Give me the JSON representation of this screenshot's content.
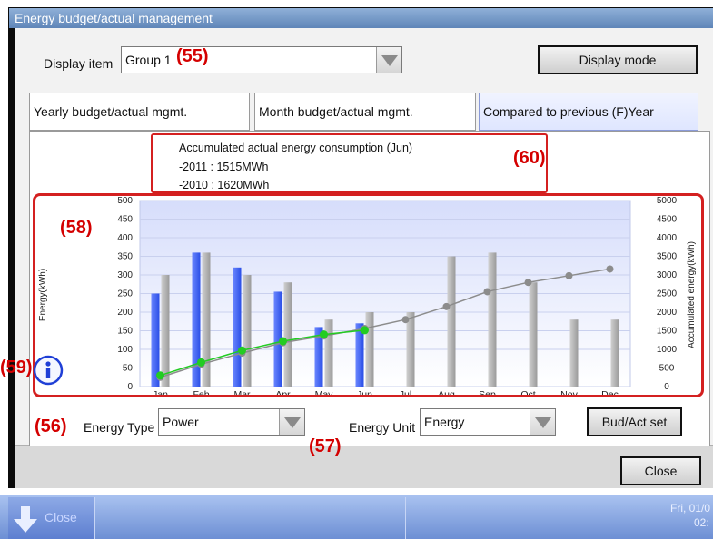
{
  "window": {
    "title": "Energy budget/actual management"
  },
  "display_item": {
    "label": "Display item",
    "value": "Group 1",
    "callout": "(55)"
  },
  "display_mode_button": "Display mode",
  "tabs": [
    {
      "label": "Yearly budget/actual mgmt.",
      "active": false
    },
    {
      "label": "Month budget/actual mgmt.",
      "active": false
    },
    {
      "label": "Compared to previous (F)Year",
      "active": true
    }
  ],
  "info": {
    "line1": "Accumulated actual energy consumption (Jun)",
    "line2": "-2011 : 1515MWh",
    "line3": "-2010 : 1620MWh",
    "callout": "(60)"
  },
  "callouts": {
    "chart": "(58)",
    "info_icon": "(59)",
    "energy_type": "(56)",
    "energy_unit": "(57)"
  },
  "energy_type": {
    "label": "Energy Type",
    "value": "Power"
  },
  "energy_unit": {
    "label": "Energy Unit",
    "value": "Energy"
  },
  "bud_act_button": "Bud/Act set",
  "close_button": "Close",
  "status": {
    "close_label": "Close",
    "date": "Fri, 01/0",
    "time": "02:"
  },
  "colors": {
    "current_year_bar": "#3a5ff0",
    "previous_year_bar": "#a8a8a8",
    "current_line": "#22cc22",
    "previous_line": "#8c8c8c",
    "callout": "#d40000"
  },
  "chart_data": {
    "type": "bar",
    "categories": [
      "Jan",
      "Feb",
      "Mar",
      "Apr",
      "May",
      "Jun",
      "Jul",
      "Aug",
      "Sep",
      "Oct",
      "Nov",
      "Dec"
    ],
    "ylabel": "Energy(kWh)",
    "y2label": "Accumulated energy(kWh)",
    "ylim": [
      0,
      500
    ],
    "y2lim": [
      0,
      5000
    ],
    "yticks": [
      0,
      50,
      100,
      150,
      200,
      250,
      300,
      350,
      400,
      450,
      500
    ],
    "y2ticks": [
      0,
      500,
      1000,
      1500,
      2000,
      2500,
      3000,
      3500,
      4000,
      4500,
      5000
    ],
    "series": [
      {
        "kind": "bar",
        "axis": "left",
        "values": [
          250,
          360,
          320,
          255,
          160,
          170,
          null,
          null,
          null,
          null,
          null,
          null
        ]
      },
      {
        "kind": "bar",
        "axis": "left",
        "values": [
          300,
          360,
          300,
          280,
          180,
          200,
          200,
          350,
          360,
          280,
          180,
          180
        ]
      },
      {
        "kind": "line",
        "axis": "right",
        "values": [
          300,
          650,
          970,
          1220,
          1400,
          1515,
          null,
          null,
          null,
          null,
          null,
          null
        ]
      },
      {
        "kind": "line",
        "axis": "right",
        "values": [
          250,
          600,
          900,
          1180,
          1360,
          1560,
          1800,
          2150,
          2550,
          2800,
          2980,
          3160
        ]
      }
    ]
  }
}
